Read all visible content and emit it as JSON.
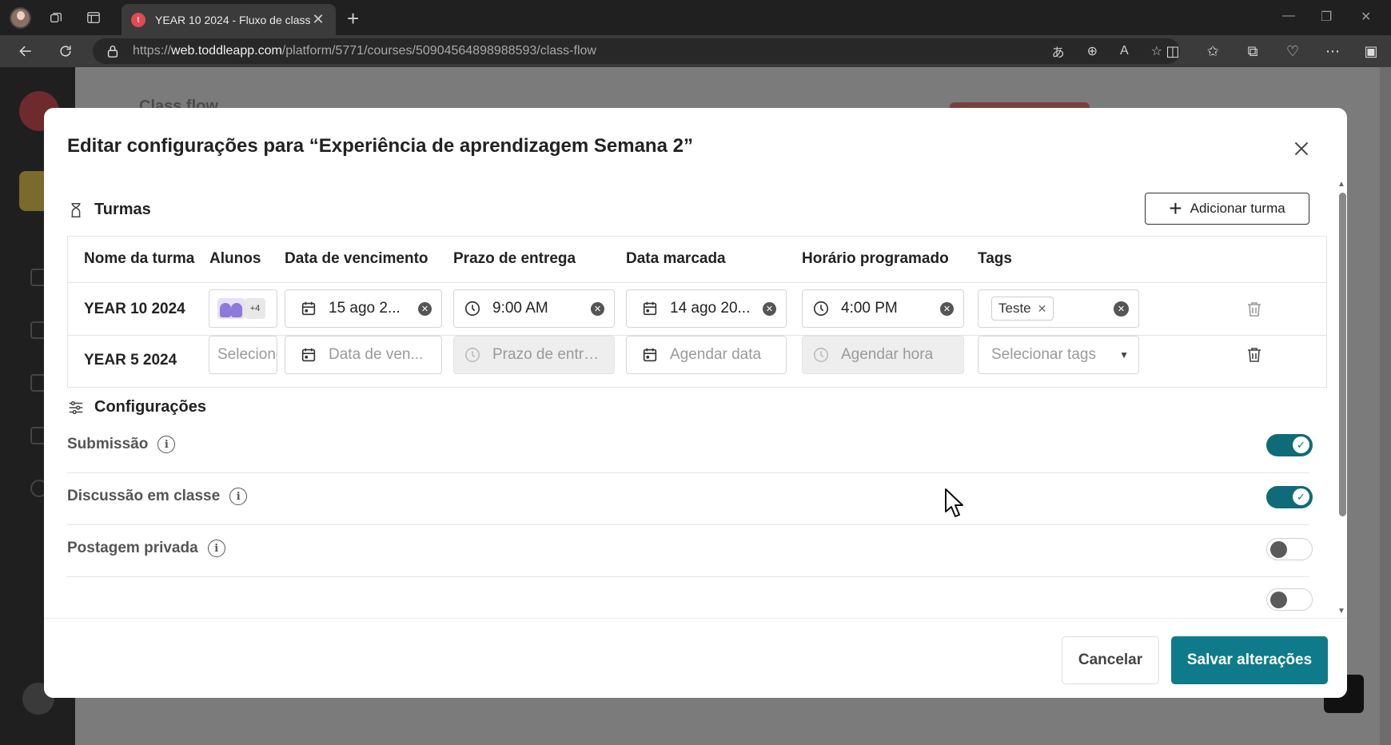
{
  "browser": {
    "tab_title": "YEAR 10 2024 - Fluxo de classe",
    "tab_favicon": "t",
    "url_prefix": "https://",
    "url_host": "web.toddleapp.com",
    "url_path": "/platform/5771/courses/50904564898988593/class-flow"
  },
  "background": {
    "page_title": "Class flow"
  },
  "modal": {
    "title": "Editar configurações para “Experiência de aprendizagem Semana 2”",
    "classes_section": {
      "heading": "Turmas",
      "add_button": "Adicionar turma",
      "columns": [
        "Nome da turma",
        "Alunos",
        "Data de vencimento",
        "Prazo de entrega",
        "Data marcada",
        "Horário programado",
        "Tags"
      ],
      "rows": [
        {
          "name": "YEAR 10 2024",
          "students_more": "+4",
          "due_date": "15 ago 2...",
          "deadline": "9:00 AM",
          "scheduled_date": "14 ago 20...",
          "scheduled_time": "4:00 PM",
          "tag": "Teste"
        },
        {
          "name": "YEAR 5 2024",
          "students_placeholder": "Selecione",
          "due_date_placeholder": "Data de ven...",
          "deadline_placeholder": "Prazo de entrega",
          "scheduled_date_placeholder": "Agendar data",
          "scheduled_time_placeholder": "Agendar hora",
          "tags_placeholder": "Selecionar tags"
        }
      ]
    },
    "settings_section": {
      "heading": "Configurações",
      "items": [
        {
          "label": "Submissão",
          "enabled": true
        },
        {
          "label": "Discussão em classe",
          "enabled": true
        },
        {
          "label": "Postagem privada",
          "enabled": false
        }
      ]
    },
    "footer": {
      "cancel": "Cancelar",
      "save": "Salvar alterações"
    }
  },
  "colors": {
    "accent": "#0f7b8a",
    "toggle_on": "#0f6b78",
    "overlay": "#7b7b7b"
  }
}
